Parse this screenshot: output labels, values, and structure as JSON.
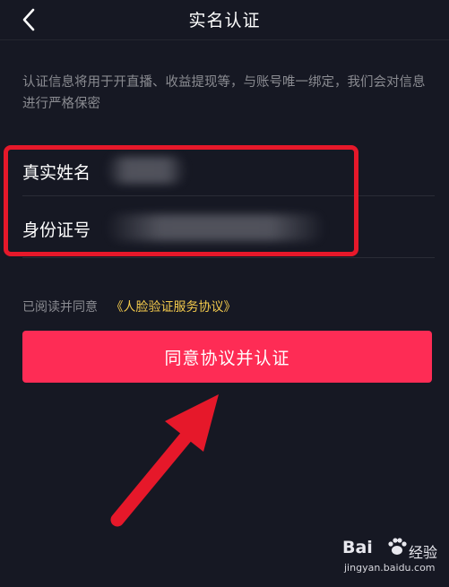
{
  "nav": {
    "title": "实名认证",
    "back_icon": "chevron-left-icon"
  },
  "notice": {
    "text": "认证信息将用于开直播、收益提现等，与账号唯一绑定，我们会对信息进行严格保密"
  },
  "form": {
    "fields": [
      {
        "label": "真实姓名",
        "value_state": "blurred"
      },
      {
        "label": "身份证号",
        "value_state": "blurred"
      }
    ]
  },
  "agreement": {
    "prefix": "已阅读并同意",
    "link": "《人脸验证服务协议》"
  },
  "cta": {
    "label": "同意协议并认证"
  },
  "watermark": {
    "brand": "Bai",
    "suffix": "经验",
    "url": "jingyan.baidu.com"
  },
  "colors": {
    "background": "#161823",
    "primary": "#fe2c55",
    "link": "#f2c94c",
    "muted_text": "#8a8b91",
    "annotation_red": "#e6182a"
  }
}
